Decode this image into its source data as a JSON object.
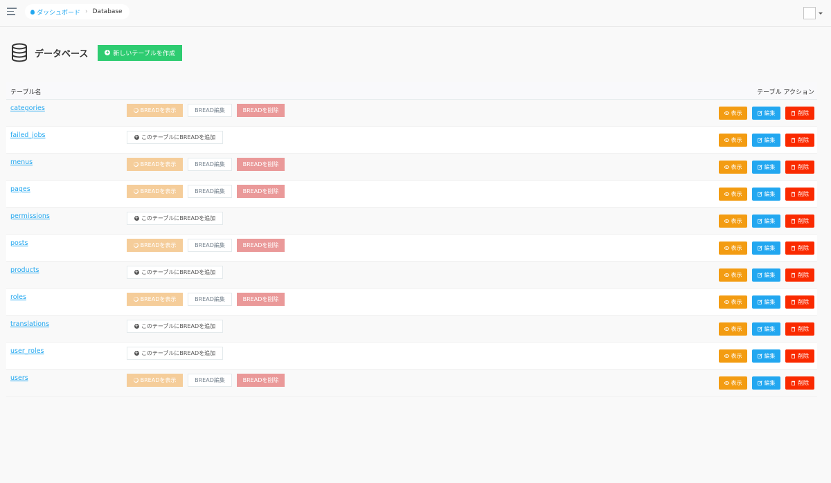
{
  "breadcrumb": {
    "home": "ダッシュボード",
    "current": "Database"
  },
  "header": {
    "title": "データベース",
    "create_button": "新しいテーブルを作成"
  },
  "table": {
    "col_name": "テーブル名",
    "col_actions": "テーブル アクション",
    "labels": {
      "bread_show": "BREADを表示",
      "bread_edit": "BREAD編集",
      "bread_delete": "BREADを削除",
      "bread_add": "このテーブルにBREADを追加",
      "view": "表示",
      "edit": "編集",
      "delete": "削除"
    },
    "rows": [
      {
        "name": "categories",
        "has_bread": true
      },
      {
        "name": "failed_jobs",
        "has_bread": false
      },
      {
        "name": "menus",
        "has_bread": true
      },
      {
        "name": "pages",
        "has_bread": true
      },
      {
        "name": "permissions",
        "has_bread": false
      },
      {
        "name": "posts",
        "has_bread": true
      },
      {
        "name": "products",
        "has_bread": false
      },
      {
        "name": "roles",
        "has_bread": true
      },
      {
        "name": "translations",
        "has_bread": false
      },
      {
        "name": "user_roles",
        "has_bread": false
      },
      {
        "name": "users",
        "has_bread": true
      }
    ]
  },
  "colors": {
    "accent": "#22a7f0",
    "create": "#2ecc71",
    "view": "#f39c12",
    "edit": "#22a7f0",
    "delete": "#fa2a00"
  },
  "icons": {
    "menu": "hamburger-icon",
    "home": "drop-icon",
    "database": "database-icon",
    "create": "plus-circle-icon",
    "view": "eye-icon",
    "edit": "pencil-square-icon",
    "delete": "trash-icon"
  }
}
